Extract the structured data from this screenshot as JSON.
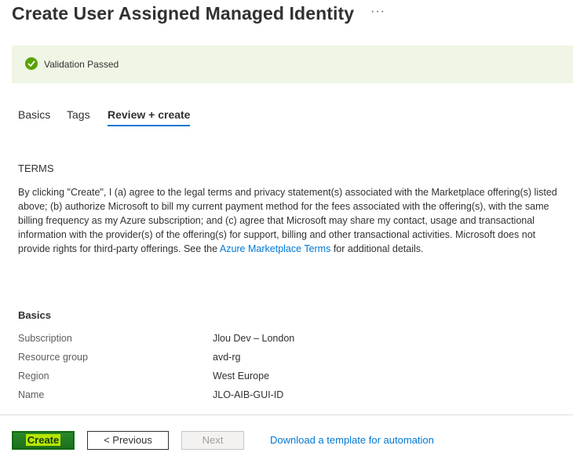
{
  "header": {
    "title": "Create User Assigned Managed Identity",
    "more_label": "···"
  },
  "validation": {
    "text": "Validation Passed",
    "status_color": "#57a300"
  },
  "tabs": [
    {
      "label": "Basics",
      "active": false
    },
    {
      "label": "Tags",
      "active": false
    },
    {
      "label": "Review + create",
      "active": true
    }
  ],
  "terms": {
    "heading": "TERMS",
    "body_before_link": "By clicking \"Create\", I (a) agree to the legal terms and privacy statement(s) associated with the Marketplace offering(s) listed above; (b) authorize Microsoft to bill my current payment method for the fees associated with the offering(s), with the same billing frequency as my Azure subscription; and (c) agree that Microsoft may share my contact, usage and transactional information with the provider(s) of the offering(s) for support, billing and other transactional activities. Microsoft does not provide rights for third-party offerings. See the ",
    "link_text": "Azure Marketplace Terms",
    "body_after_link": " for additional details."
  },
  "basics": {
    "heading": "Basics",
    "rows": [
      {
        "label": "Subscription",
        "value": "Jlou Dev – London"
      },
      {
        "label": "Resource group",
        "value": "avd-rg"
      },
      {
        "label": "Region",
        "value": "West Europe"
      },
      {
        "label": "Name",
        "value": "JLO-AIB-GUI-ID"
      }
    ]
  },
  "footer": {
    "create_label": "Create",
    "previous_label": "< Previous",
    "next_label": "Next",
    "download_label": "Download a template for automation"
  },
  "colors": {
    "accent": "#0078d4",
    "banner_bg": "#eff6e5"
  }
}
